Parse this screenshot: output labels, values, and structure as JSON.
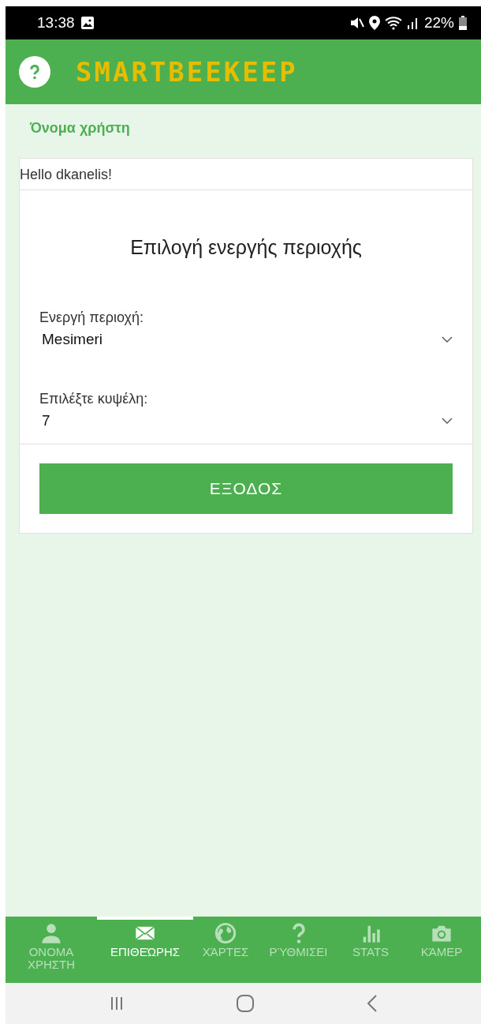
{
  "status_bar": {
    "time": "13:38",
    "battery": "22%"
  },
  "app_bar": {
    "logo": "SMARTBEEKEEP"
  },
  "section_title": "Όνομα χρήστη",
  "greeting": "Hello dkanelis!",
  "card": {
    "title": "Επιλογή ενεργής περιοχής",
    "fields": [
      {
        "label": "Ενεργή περιοχή:",
        "value": "Mesimeri"
      },
      {
        "label": "Επιλέξτε κυψέλη:",
        "value": "7"
      }
    ],
    "button": "ΕΞΟΔΟΣ"
  },
  "bottom_nav": [
    {
      "label": "ΟΝΟΜΑ ΧΡΗΣΤΗ",
      "kind": "person",
      "selected": false
    },
    {
      "label": "ΕΠΙΘΕΏΡΗΣ",
      "kind": "mail",
      "selected": true
    },
    {
      "label": "ΧΆΡΤΕΣ",
      "kind": "globe",
      "selected": false
    },
    {
      "label": "ΡΎΘΜΙΣΕΙ",
      "kind": "help",
      "selected": false
    },
    {
      "label": "STATS",
      "kind": "chart",
      "selected": false
    },
    {
      "label": "ΚΆΜΕΡ",
      "kind": "camera",
      "selected": false
    }
  ]
}
